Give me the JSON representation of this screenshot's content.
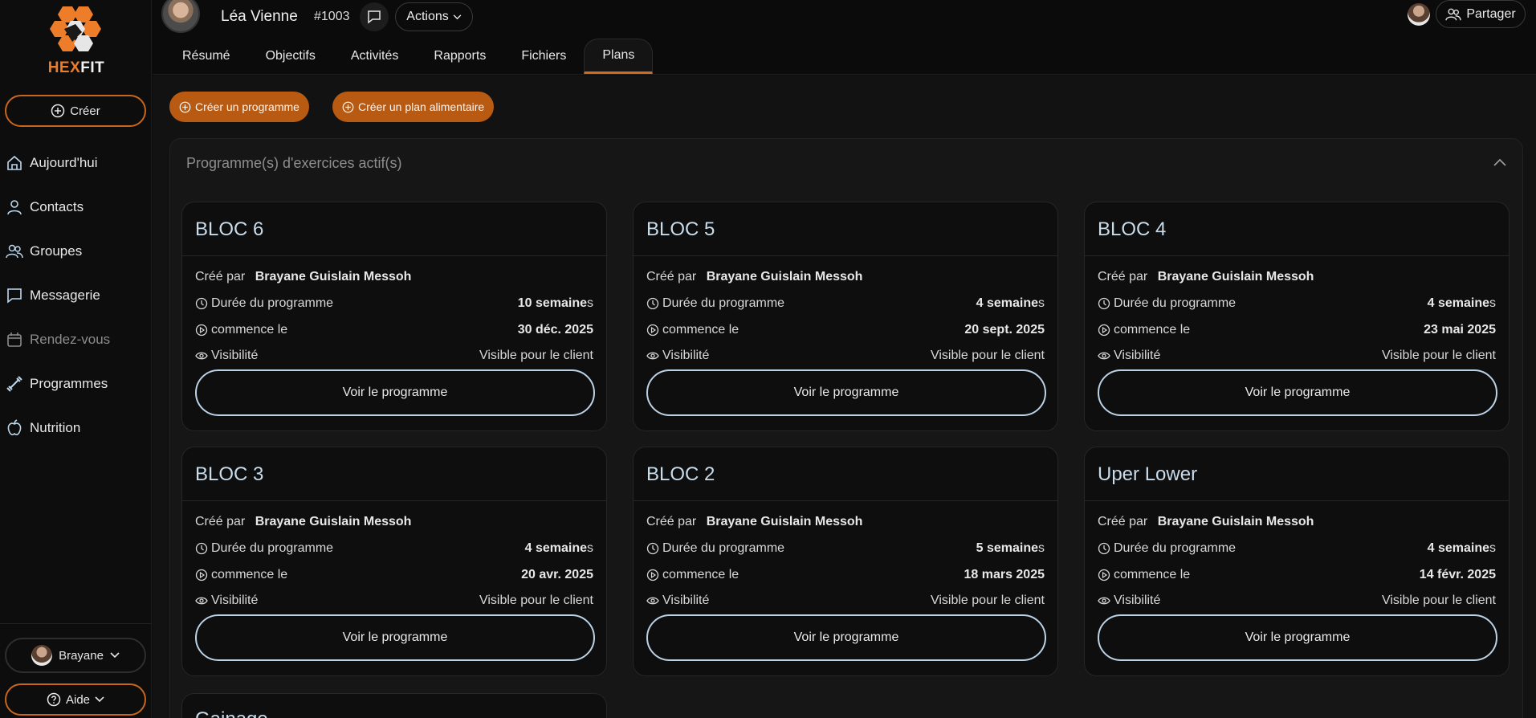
{
  "brand": {
    "name_part1": "HEX",
    "name_part2": "FIT",
    "accent": "#ee7d2a"
  },
  "sidebar": {
    "create_label": "Créer",
    "items": [
      {
        "label": "Aujourd'hui",
        "icon": "home-icon"
      },
      {
        "label": "Contacts",
        "icon": "user-icon"
      },
      {
        "label": "Groupes",
        "icon": "users-icon"
      },
      {
        "label": "Messagerie",
        "icon": "message-icon"
      },
      {
        "label": "Rendez-vous",
        "icon": "calendar-icon"
      },
      {
        "label": "Programmes",
        "icon": "dumbbell-icon"
      },
      {
        "label": "Nutrition",
        "icon": "apple-icon"
      }
    ],
    "user_label": "Brayane",
    "help_label": "Aide"
  },
  "header": {
    "client_name": "Léa Vienne",
    "client_id": "#1003",
    "actions_label": "Actions",
    "share_label": "Partager",
    "tabs": [
      "Résumé",
      "Objectifs",
      "Activités",
      "Rapports",
      "Fichiers",
      "Plans"
    ],
    "active_tab": "Plans"
  },
  "main": {
    "create_program_label": "Créer un programme",
    "create_meal_plan_label": "Créer un plan alimentaire",
    "panel_title": "Programme(s) d'exercices actif(s)",
    "labels": {
      "created_by": "Créé par",
      "duration": "Durée du programme",
      "starts": "commence le",
      "visibility": "Visibilité",
      "view": "Voir le programme"
    },
    "programs": [
      {
        "title": "BLOC 6",
        "author": "Brayane Guislain Messoh",
        "duration": "10 semaine",
        "duration_suffix": "s",
        "start": "30 déc. 2025",
        "visibility": "Visible pour le client"
      },
      {
        "title": "BLOC 5",
        "author": "Brayane Guislain Messoh",
        "duration": "4 semaine",
        "duration_suffix": "s",
        "start": "20 sept. 2025",
        "visibility": "Visible pour le client"
      },
      {
        "title": "BLOC 4",
        "author": "Brayane Guislain Messoh",
        "duration": "4 semaine",
        "duration_suffix": "s",
        "start": "23 mai 2025",
        "visibility": "Visible pour le client"
      },
      {
        "title": "BLOC 3",
        "author": "Brayane Guislain Messoh",
        "duration": "4 semaine",
        "duration_suffix": "s",
        "start": "20 avr. 2025",
        "visibility": "Visible pour le client"
      },
      {
        "title": "BLOC 2",
        "author": "Brayane Guislain Messoh",
        "duration": "5 semaine",
        "duration_suffix": "s",
        "start": "18 mars 2025",
        "visibility": "Visible pour le client"
      },
      {
        "title": "Uper Lower",
        "author": "Brayane Guislain Messoh",
        "duration": "4 semaine",
        "duration_suffix": "s",
        "start": "14 févr. 2025",
        "visibility": "Visible pour le client"
      }
    ],
    "partial_program_title": "Gainage"
  }
}
